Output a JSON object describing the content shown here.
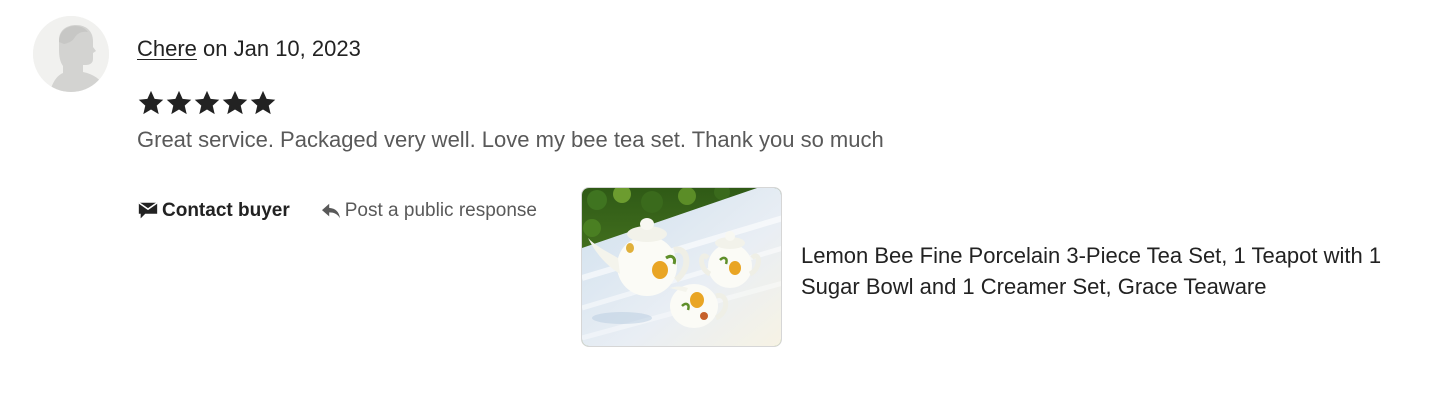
{
  "review": {
    "reviewer_name": "Chere",
    "date_text": " on Jan 10, 2023",
    "rating": 5,
    "rating_max": 5,
    "text": "Great service. Packaged very well. Love my bee tea set. Thank you so much"
  },
  "actions": {
    "contact_label": "Contact buyer",
    "contact_icon": "message-icon",
    "post_label": "Post a public response",
    "post_icon": "reply-arrow-icon"
  },
  "product": {
    "title": "Lemon Bee Fine Porcelain 3-Piece Tea Set, 1 Teapot with 1 Sugar Bowl and 1 Creamer Set, Grace Teaware"
  },
  "colors": {
    "text_primary": "#222222",
    "text_secondary": "#595959",
    "star": "#222222",
    "avatar_bg": "#f1f1ef",
    "avatar_figure": "#d3d3d1"
  }
}
